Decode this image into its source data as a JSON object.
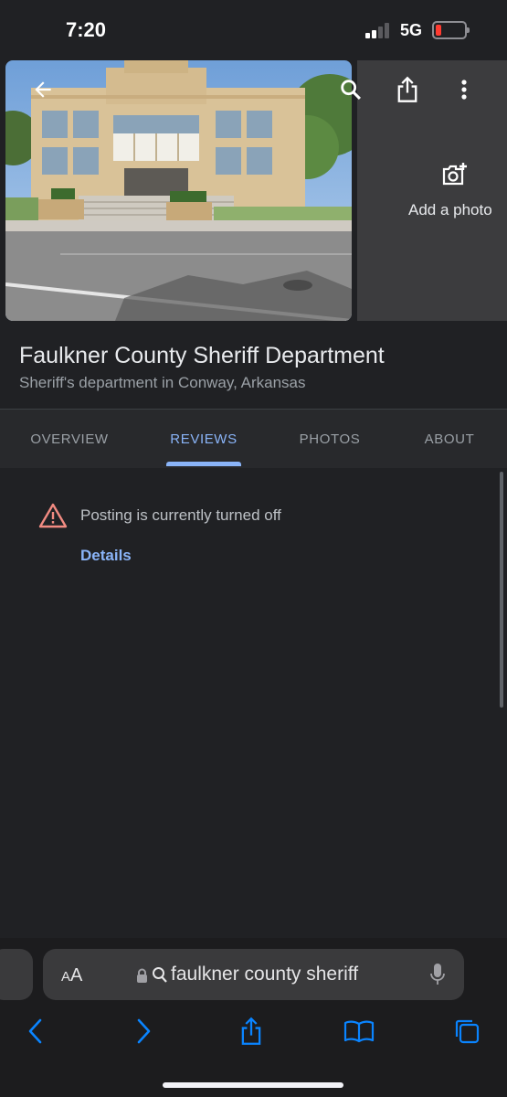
{
  "status": {
    "time": "7:20",
    "network": "5G"
  },
  "hero": {
    "add_photo_label": "Add a photo"
  },
  "place": {
    "title": "Faulkner County Sheriff Department",
    "subtitle": "Sheriff's department in Conway, Arkansas"
  },
  "tabs": [
    {
      "label": "OVERVIEW",
      "active": false
    },
    {
      "label": "REVIEWS",
      "active": true
    },
    {
      "label": "PHOTOS",
      "active": false
    },
    {
      "label": "ABOUT",
      "active": false
    }
  ],
  "notice": {
    "text": "Posting is currently turned off",
    "link": "Details"
  },
  "browser": {
    "text_size_small": "A",
    "text_size_big": "A",
    "url": "faulkner county sheriff"
  },
  "icons": {
    "back": "arrow-left-icon",
    "search": "search-icon",
    "share": "share-icon",
    "more": "more-vert-icon",
    "add_photo": "camera-plus-icon",
    "warning": "warning-icon",
    "lock": "lock-icon",
    "microphone": "microphone-icon",
    "bookmarks": "book-icon",
    "tabs": "tabs-icon"
  },
  "colors": {
    "accent": "#8ab4f8",
    "warning": "#f28b82",
    "background": "#202124"
  }
}
